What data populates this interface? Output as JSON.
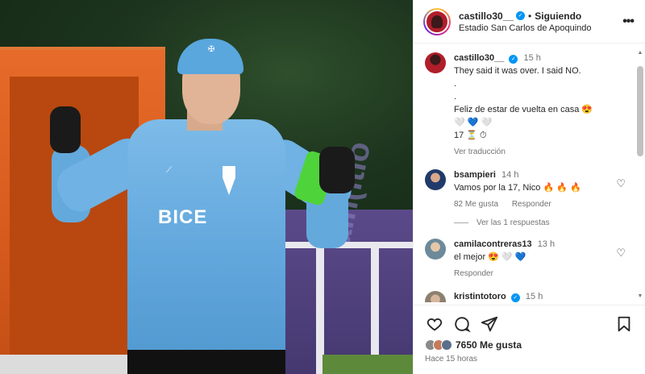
{
  "photo": {
    "shirt_sponsor": "BICE",
    "banner_text": "aln(ltio"
  },
  "header": {
    "username": "castillo30__",
    "separator": "•",
    "follow_label": "Siguiendo",
    "location": "Estadio San Carlos de Apoquindo",
    "more_label": "•••"
  },
  "caption": {
    "username": "castillo30__",
    "time": "15 h",
    "lines": [
      "They said it was over. I said NO.",
      ".",
      ".",
      "Feliz de estar de vuelta en casa 😍"
    ],
    "hearts": "🤍 💙 🤍",
    "emoji_line": "17 ⏳ ⏱",
    "translate": "Ver traducción"
  },
  "comments": [
    {
      "username": "bsampieri",
      "time": "14 h",
      "text": "Vamos por la 17, Nico 🔥 🔥 🔥",
      "likes": "82 Me gusta",
      "reply": "Responder",
      "replies_toggle": "Ver las 1 respuestas"
    },
    {
      "username": "camilacontreras13",
      "time": "13 h",
      "text": "el mejor 😍 🤍 💙",
      "reply": "Responder"
    },
    {
      "username": "kristintotoro",
      "time": "15 h"
    }
  ],
  "actions": {
    "likes_label": "7650 Me gusta",
    "posted_ago": "Hace 15 horas"
  },
  "icons": [
    "heart-icon",
    "comment-icon",
    "share-icon",
    "bookmark-icon",
    "verified-icon",
    "more-icon"
  ],
  "colors": {
    "verified": "#0095f6",
    "text": "#262626",
    "muted": "#737373"
  }
}
